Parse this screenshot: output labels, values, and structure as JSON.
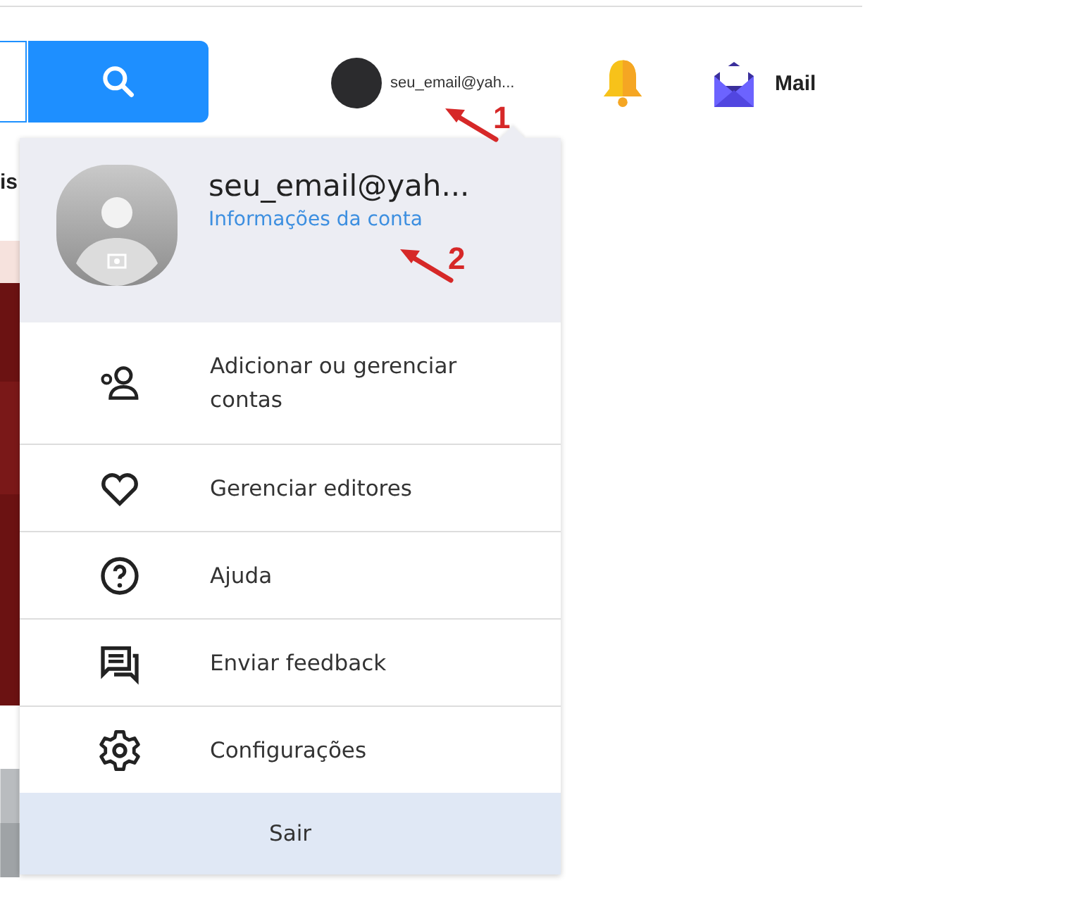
{
  "header": {
    "account_name": "seu_email@yah...",
    "mail_label": "Mail"
  },
  "background_text": "is",
  "account_menu": {
    "name": "seu_email@yah...",
    "account_link": "Informações da conta",
    "items": [
      {
        "kind": "accounts",
        "label": "Adicionar ou gerenciar contas"
      },
      {
        "kind": "heart",
        "label": "Gerenciar editores"
      },
      {
        "kind": "help",
        "label": "Ajuda"
      },
      {
        "kind": "feedback",
        "label": "Enviar feedback"
      },
      {
        "kind": "settings",
        "label": "Configurações"
      }
    ],
    "sign_out": "Sair"
  },
  "annotations": [
    {
      "label": "1"
    },
    {
      "label": "2"
    }
  ]
}
